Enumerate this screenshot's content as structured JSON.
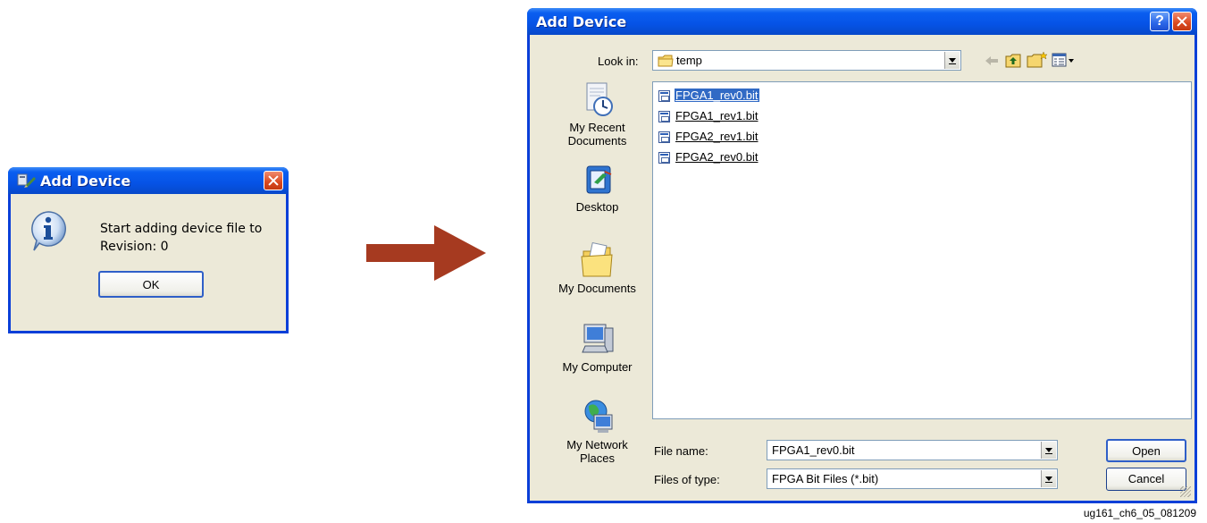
{
  "msgbox": {
    "title": "Add Device",
    "message_line1": "Start adding device file to",
    "message_line2": "Revision: 0",
    "ok_label": "OK"
  },
  "arrow": {
    "color": "#a63a20"
  },
  "file_dialog": {
    "title": "Add Device",
    "look_in_label": "Look in:",
    "look_in_value": "temp",
    "places": [
      {
        "label_line1": "My Recent",
        "label_line2": "Documents"
      },
      {
        "label_line1": "Desktop",
        "label_line2": ""
      },
      {
        "label_line1": "My Documents",
        "label_line2": ""
      },
      {
        "label_line1": "My Computer",
        "label_line2": ""
      },
      {
        "label_line1": "My Network",
        "label_line2": "Places"
      }
    ],
    "files": [
      "FPGA1_rev0.bit",
      "FPGA1_rev1.bit",
      "FPGA2_rev1.bit",
      "FPGA2_rev0.bit"
    ],
    "selected_file_index": 0,
    "file_name_label": "File name:",
    "file_name_value": "FPGA1_rev0.bit",
    "files_of_type_label": "Files of type:",
    "files_of_type_value": "FPGA Bit Files (*.bit)",
    "open_label": "Open",
    "cancel_label": "Cancel"
  },
  "caption": "ug161_ch6_05_081209",
  "colors": {
    "title_bar": "#0653e6",
    "dialog_face": "#ece9d8",
    "selection": "#316ac5"
  }
}
